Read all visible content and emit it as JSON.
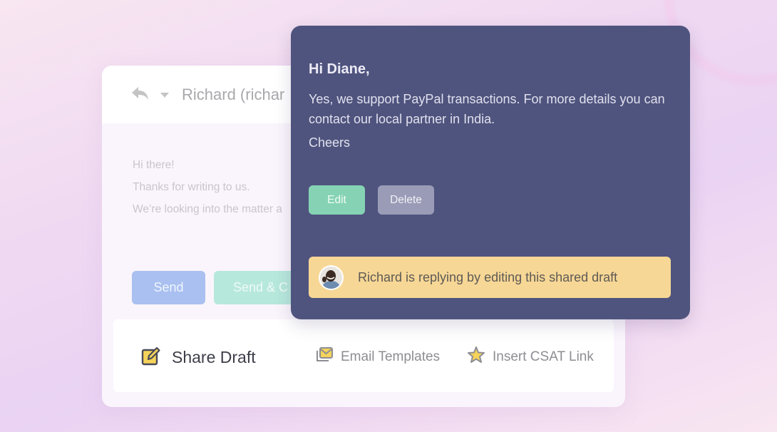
{
  "composer": {
    "recipient": "Richard (richar",
    "body_lines": [
      "Hi there!",
      "Thanks for writing to us.",
      "We’re looking into the matter a"
    ],
    "buttons": {
      "send": "Send",
      "send_close": "Send & C"
    },
    "toolbar": {
      "share_draft": "Share Draft",
      "email_templates": "Email Templates",
      "insert_csat": "Insert CSAT Link"
    },
    "icons": {
      "reply": "reply-icon",
      "caret": "chevron-down-icon",
      "share_draft": "edit-square-icon",
      "email_templates": "envelope-stack-icon",
      "insert_csat": "star-icon"
    }
  },
  "draft_card": {
    "greeting": "Hi Diane,",
    "message": "Yes, we support PayPal transactions. For more details you can contact our local partner in India.",
    "signoff": "Cheers",
    "buttons": {
      "edit": "Edit",
      "delete": "Delete"
    },
    "status": {
      "text": "Richard is replying by editing this shared draft",
      "avatar": "avatar-richard"
    }
  },
  "colors": {
    "card_dark": "#4f547e",
    "edit_green": "#85d3b4",
    "delete_gray": "#9a9cb7",
    "banner_yellow": "#f7d795",
    "send_blue": "#a9c0f0",
    "send_close_mint": "#b7e8dc",
    "icon_yellow": "#f5d35a"
  }
}
